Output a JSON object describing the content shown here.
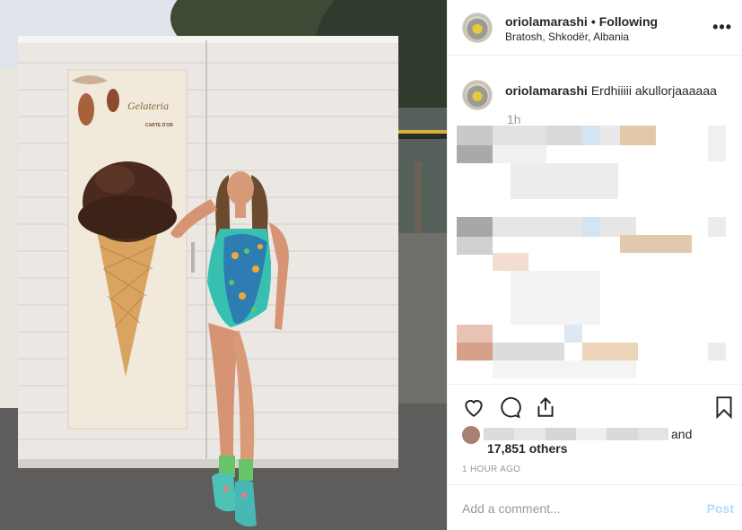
{
  "post": {
    "username": "oriolamarashi",
    "separator": "•",
    "follow_status": "Following",
    "location": "Bratosh, Shkodër, Albania",
    "more_icon": "more-options-icon",
    "more_label": "•••"
  },
  "caption": {
    "username": "oriolamarashi",
    "text": "Erdhiiiii akullorjaaaaaa",
    "time_ago": "1h"
  },
  "photo": {
    "poster_brand": "Gelateria",
    "poster_sub": "CARTE D'OR"
  },
  "actions": {
    "like_icon": "heart-icon",
    "comment_icon": "comment-icon",
    "share_icon": "share-icon",
    "save_icon": "bookmark-icon"
  },
  "likes": {
    "and_text": "and",
    "others_text": "17,851 others"
  },
  "timestamp": "1 HOUR AGO",
  "comment": {
    "placeholder": "Add a comment...",
    "post_label": "Post"
  },
  "colors": {
    "text": "#262626",
    "muted": "#999999",
    "post_disabled": "#b3dbff",
    "border": "#efefef"
  }
}
